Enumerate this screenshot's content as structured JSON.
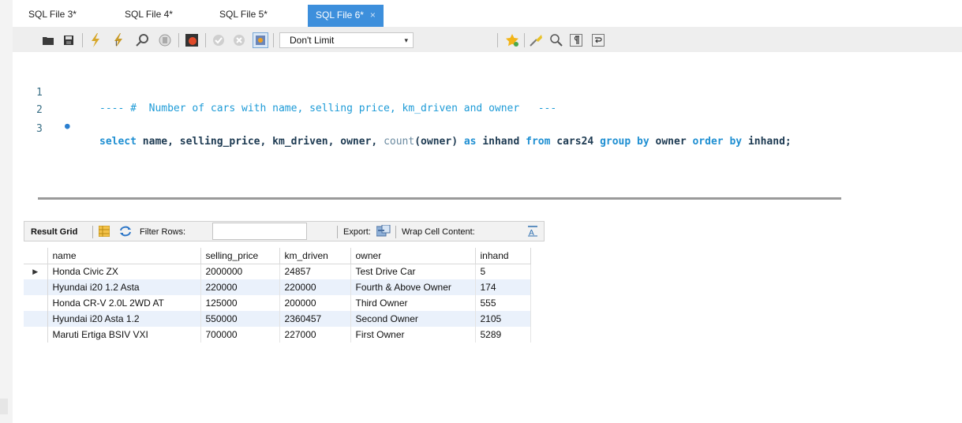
{
  "tabs": [
    {
      "label": "SQL File 3*"
    },
    {
      "label": "SQL File 4*"
    },
    {
      "label": "SQL File 5*"
    },
    {
      "label": "SQL File 6*",
      "active": true,
      "close": "×"
    }
  ],
  "toolbar": {
    "limit_value": "Don't Limit",
    "limit_arrow": "▾",
    "icons": [
      "open-folder-icon",
      "save-icon",
      "execute-icon",
      "execute-current-icon",
      "explain-icon",
      "stop-icon",
      "toggle-error-icon",
      "commit-icon",
      "rollback-icon",
      "autocommit-icon",
      "beautify-icon",
      "bookmark-icon",
      "find-icon",
      "invisible-chars-icon",
      "wrap-icon"
    ]
  },
  "editor": {
    "lines": [
      {
        "num": "1",
        "marker": "",
        "text": "---- #  Number of cars with name, selling price, km_driven and owner   ---"
      },
      {
        "num": "2",
        "marker": "●",
        "text": "select name, selling_price, km_driven, owner, count(owner) as inhand from cars24 group by owner order by inhand;"
      },
      {
        "num": "3",
        "marker": "",
        "text": ""
      }
    ]
  },
  "result_toolbar": {
    "result_grid": "Result Grid",
    "filter_rows": "Filter Rows:",
    "filter_value": "",
    "export": "Export:",
    "wrap": "Wrap Cell Content:"
  },
  "grid": {
    "columns": [
      "name",
      "selling_price",
      "km_driven",
      "owner",
      "inhand"
    ],
    "rows": [
      [
        "Honda Civic ZX",
        "2000000",
        "24857",
        "Test Drive Car",
        "5"
      ],
      [
        "Hyundai i20 1.2 Asta",
        "220000",
        "220000",
        "Fourth & Above Owner",
        "174"
      ],
      [
        "Honda CR-V 2.0L 2WD AT",
        "125000",
        "200000",
        "Third Owner",
        "555"
      ],
      [
        "Hyundai i20 Asta 1.2",
        "550000",
        "2360457",
        "Second Owner",
        "2105"
      ],
      [
        "Maruti Ertiga BSIV VXI",
        "700000",
        "227000",
        "First Owner",
        "5289"
      ]
    ],
    "current_row_marker": "▶"
  },
  "colors": {
    "accent": "#3d8fdc",
    "row_alt": "#eaf1fb"
  }
}
